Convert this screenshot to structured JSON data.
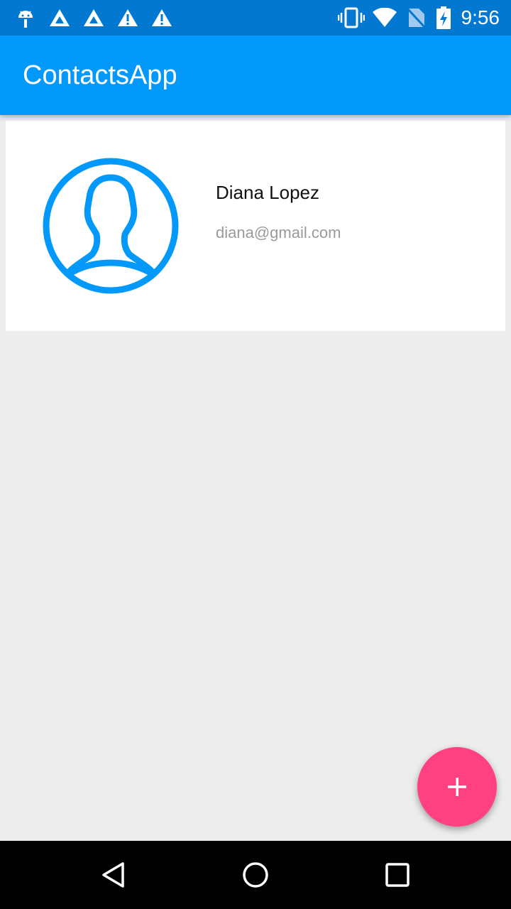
{
  "status_bar": {
    "time": "9:56",
    "left_icons": [
      "android-debug-icon",
      "triangle-icon",
      "triangle-icon",
      "warning-icon",
      "warning-icon"
    ],
    "right_icons": [
      "vibrate-icon",
      "wifi-icon",
      "no-sim-icon",
      "battery-charging-icon"
    ]
  },
  "app_bar": {
    "title": "ContactsApp",
    "color": "#0399fb"
  },
  "contacts": [
    {
      "name": "Diana Lopez",
      "email": "diana@gmail.com",
      "avatar_icon": "person-circle-icon"
    }
  ],
  "fab": {
    "icon": "add-icon",
    "color": "#ff4081"
  },
  "nav_bar": {
    "buttons": [
      "back-icon",
      "home-icon",
      "recents-icon"
    ]
  },
  "colors": {
    "primary": "#0399fb",
    "primary_dark": "#0278d1",
    "accent": "#ff4081",
    "background": "#ededed"
  }
}
